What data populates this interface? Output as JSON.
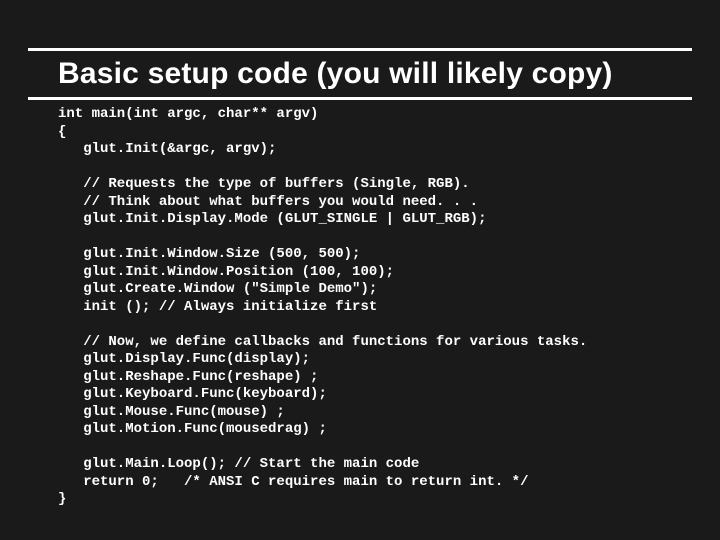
{
  "title": "Basic setup code (you will likely copy)",
  "code": "int main(int argc, char** argv)\n{\n   glut.Init(&argc, argv);\n\n   // Requests the type of buffers (Single, RGB).\n   // Think about what buffers you would need. . .\n   glut.Init.Display.Mode (GLUT_SINGLE | GLUT_RGB);\n\n   glut.Init.Window.Size (500, 500);\n   glut.Init.Window.Position (100, 100);\n   glut.Create.Window (\"Simple Demo\");\n   init (); // Always initialize first\n\n   // Now, we define callbacks and functions for various tasks.\n   glut.Display.Func(display);\n   glut.Reshape.Func(reshape) ;\n   glut.Keyboard.Func(keyboard);\n   glut.Mouse.Func(mouse) ;\n   glut.Motion.Func(mousedrag) ;\n\n   glut.Main.Loop(); // Start the main code\n   return 0;   /* ANSI C requires main to return int. */\n}"
}
